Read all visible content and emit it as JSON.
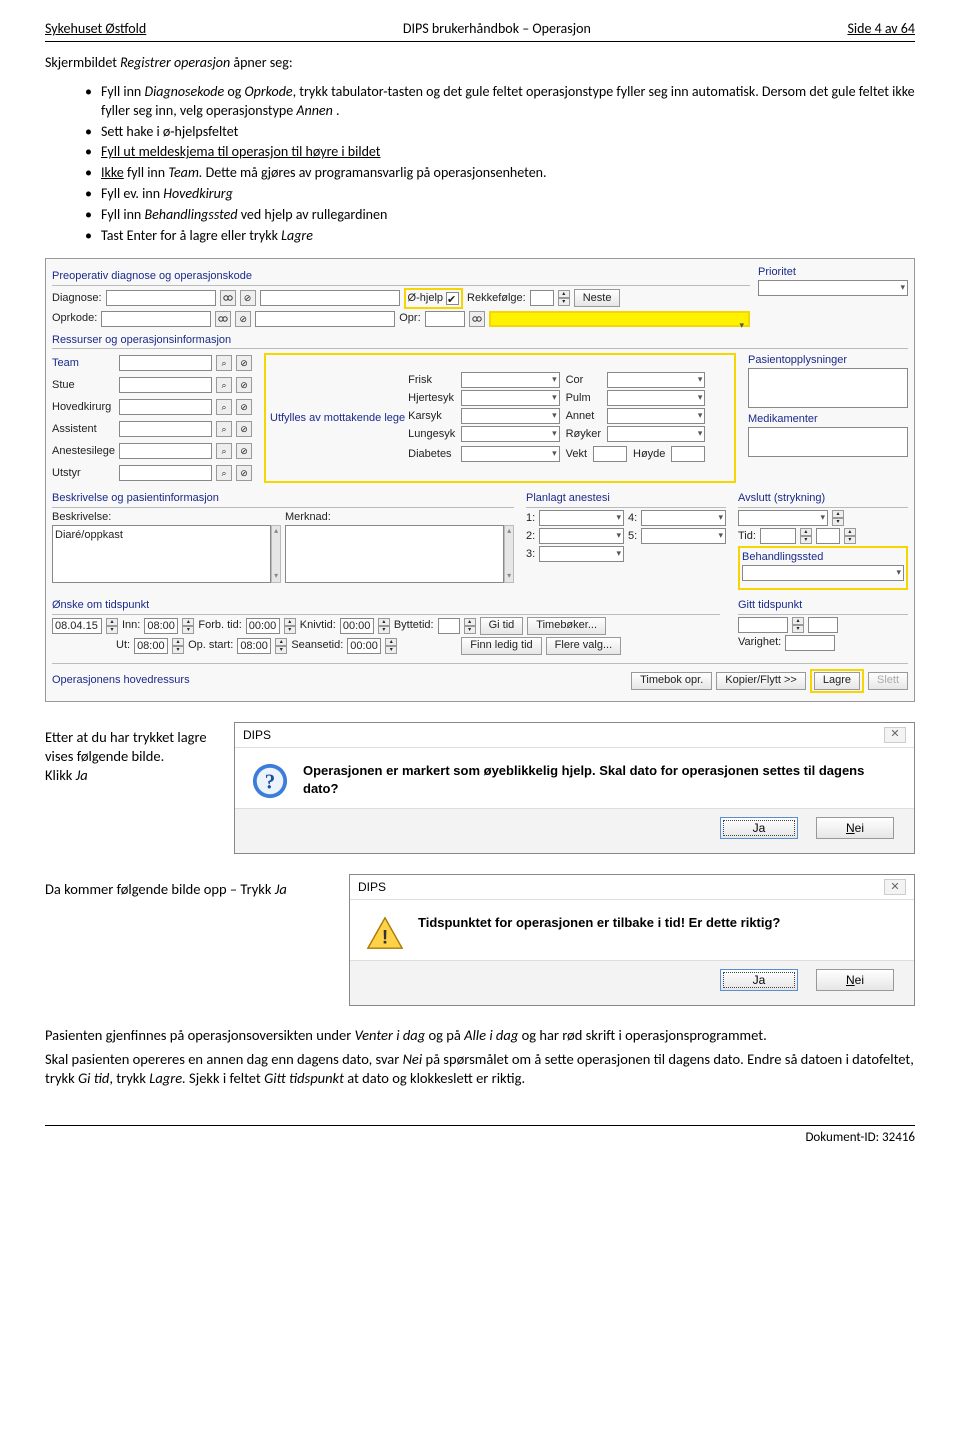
{
  "header": {
    "left": "Sykehuset Østfold",
    "center": "DIPS brukerhåndbok – Operasjon",
    "right": "Side 4 av 64"
  },
  "intro": {
    "line1_a": "Skjermbildet ",
    "line1_b": "Registrer operasjon",
    "line1_c": " åpner seg:"
  },
  "bullets": {
    "b1_a": "Fyll inn ",
    "b1_b": "Diagnosekode",
    "b1_c": " og ",
    "b1_d": "Oprkode",
    "b1_e": ", trykk tabulator-tasten og det gule feltet operasjonstype fyller seg inn automatisk. Dersom det gule feltet ikke fyller seg inn, velg operasjonstype ",
    "b1_f": "Annen",
    "b1_g": " .",
    "b2": "Sett hake i ø-hjelpsfeltet",
    "b3_a": "Fyll ut meldeskjema til operasjon til høyre i bildet",
    "b4_a": "Ikke",
    "b4_b": " fyll inn ",
    "b4_c": "Team.",
    "b4_d": " Dette må gjøres av programansvarlig på operasjonsenheten.",
    "b5_a": "Fyll ev. inn ",
    "b5_b": "Hovedkirurg",
    "b6_a": "Fyll inn ",
    "b6_b": "Behandlingssted",
    "b6_c": " ved hjelp av rullegardinen",
    "b7_a": "Tast Enter for å lagre eller trykk ",
    "b7_b": "Lagre"
  },
  "form": {
    "sec1": "Preoperativ diagnose og operasjonskode",
    "diagnose": "Diagnose:",
    "oprkode": "Oprkode:",
    "ohjelp": "Ø-hjelp",
    "rekkefolge": "Rekkefølge:",
    "neste": "Neste",
    "opr": "Opr:",
    "prioritet": "Prioritet",
    "sec2": "Ressurser og operasjonsinformasjon",
    "team": "Team",
    "stue": "Stue",
    "hovedkirurg": "Hovedkirurg",
    "assistent": "Assistent",
    "anestesilege": "Anestesilege",
    "utstyr": "Utstyr",
    "utfylles": "Utfylles av mottakende lege",
    "frisk": "Frisk",
    "hjertesyk": "Hjertesyk",
    "karsyk": "Karsyk",
    "lungesyk": "Lungesyk",
    "diabetes": "Diabetes",
    "cor": "Cor",
    "pulm": "Pulm",
    "annet": "Annet",
    "royker": "Røyker",
    "vekt": "Vekt",
    "hoyde": "Høyde",
    "pasientoppl": "Pasientopplysninger",
    "medikamenter": "Medikamenter",
    "sec3": "Beskrivelse og pasientinformasjon",
    "beskrivelse": "Beskrivelse:",
    "merknad": "Merknad:",
    "beskrivelse_val": "Diaré/oppkast",
    "planlagt": "Planlagt anestesi",
    "p1": "1:",
    "p2": "2:",
    "p3": "3:",
    "p4": "4:",
    "p5": "5:",
    "avslutt": "Avslutt (strykning)",
    "tid": "Tid:",
    "behandlingssted": "Behandlingssted",
    "onske": "Ønske om tidspunkt",
    "dato_val": "08.04.15",
    "inn": "Inn:",
    "t800": "08:00",
    "forbtid": "Forb. tid:",
    "t0000": "00:00",
    "knivtid": "Knivtid:",
    "byttetid": "Byttetid:",
    "gitid": "Gi tid",
    "timeboker": "Timebøker...",
    "ut": "Ut:",
    "opstart": "Op. start:",
    "seansetid": "Seansetid:",
    "finnledig": "Finn ledig tid",
    "flerevalg": "Flere valg...",
    "gitt": "Gitt tidspunkt",
    "varighet": "Varighet:",
    "hovedressurs": "Operasjonens hovedressurs",
    "timebokopr": "Timebok opr.",
    "kopier": "Kopier/Flytt >>",
    "lagre": "Lagre",
    "slett": "Slett"
  },
  "note1": {
    "l1": "Etter at du har trykket lagre vises følgende bilde.",
    "l2_a": "Klikk ",
    "l2_b": "Ja"
  },
  "dlg1": {
    "title": "DIPS",
    "msg": "Operasjonen er markert som øyeblikkelig hjelp. Skal dato for operasjonen settes til dagens dato?",
    "ja": "Ja",
    "nei_n": "N",
    "nei_rest": "ei"
  },
  "note2": {
    "text_a": "Da kommer følgende bilde opp – Trykk ",
    "text_b": "Ja"
  },
  "dlg2": {
    "title": "DIPS",
    "msg": "Tidspunktet for operasjonen er tilbake i tid! Er dette riktig?",
    "ja": "Ja",
    "nei_n": "N",
    "nei_rest": "ei"
  },
  "para": {
    "p1_a": "Pasienten gjenfinnes på operasjonsoversikten under ",
    "p1_b": "Venter i dag",
    "p1_c": " og på ",
    "p1_d": "Alle i dag",
    "p1_e": " og har rød skrift i operasjonsprogrammet.",
    "p2_a": "Skal pasienten opereres en annen dag enn dagens dato, svar ",
    "p2_b": "Nei",
    "p2_c": " på spørsmålet om å sette operasjonen til dagens dato. Endre så datoen i datofeltet, trykk ",
    "p2_d": "Gi tid",
    "p2_e": ", trykk ",
    "p2_f": "Lagre.",
    "p2_g": " Sjekk i feltet ",
    "p2_h": "Gitt tidspunkt",
    "p2_i": " at dato og klokkeslett er riktig."
  },
  "footer": "Dokument-ID: 32416"
}
